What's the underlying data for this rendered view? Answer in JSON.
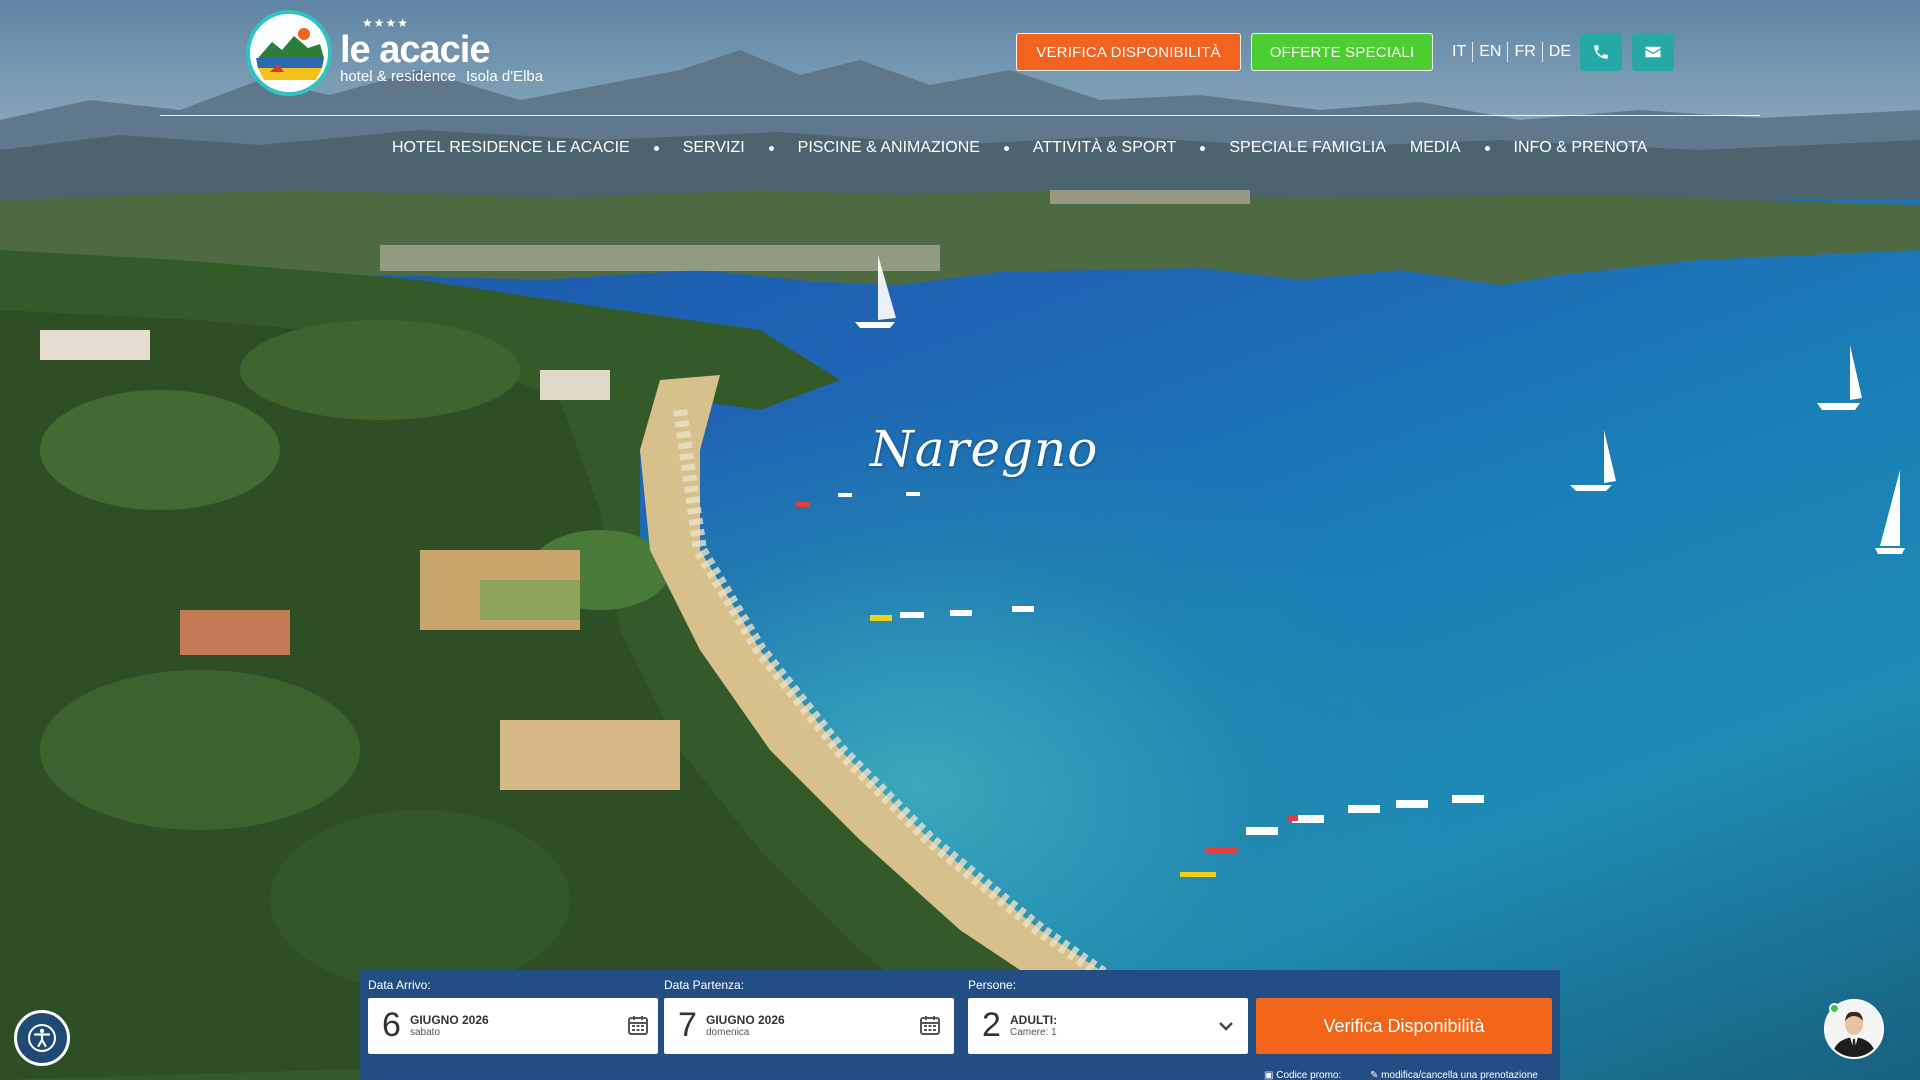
{
  "brand": {
    "stars": "★★★★",
    "name": "le acacie",
    "subtitle": "hotel & residence",
    "location": "Isola d'Elba"
  },
  "header": {
    "verify_label": "VERIFICA DISPONIBILITÀ",
    "offers_label": "OFFERTE SPECIALI",
    "languages": [
      "IT",
      "EN",
      "FR",
      "DE"
    ],
    "phone_icon": "phone-icon",
    "mail_icon": "envelope-icon"
  },
  "nav": {
    "items": [
      "HOTEL RESIDENCE LE ACACIE",
      "SERVIZI",
      "PISCINE & ANIMAZIONE",
      "ATTIVITÀ & SPORT",
      "SPECIALE FAMIGLIA",
      "MEDIA",
      "INFO & PRENOTA"
    ]
  },
  "hero": {
    "place_label": "Naregno"
  },
  "booking": {
    "arrival": {
      "label": "Data Arrivo:",
      "day": "6",
      "month": "GIUGNO 2026",
      "weekday": "sabato"
    },
    "departure": {
      "label": "Data Partenza:",
      "day": "7",
      "month": "GIUGNO 2026",
      "weekday": "domenica"
    },
    "guests": {
      "label": "Persone:",
      "count": "2",
      "type": "ADULTI:",
      "rooms": "Camere: 1"
    },
    "submit_label": "Verifica Disponibilità",
    "promo_label": "Codice promo:",
    "manage_label": "modifica/cancella una prenotazione"
  },
  "colors": {
    "accent_orange": "#f2631f",
    "accent_green": "#4ccd32",
    "accent_teal": "#26a9a6",
    "booking_bar": "#234e83"
  }
}
